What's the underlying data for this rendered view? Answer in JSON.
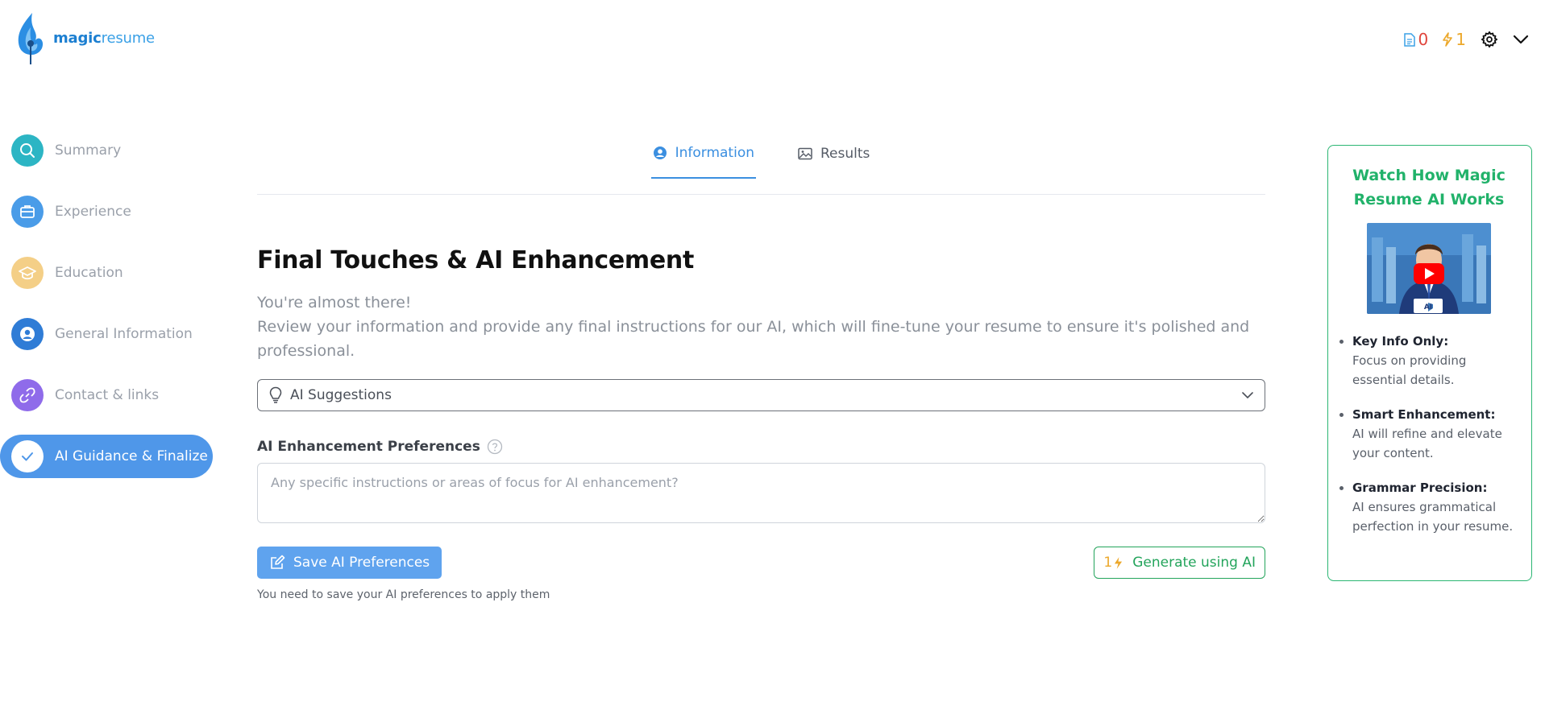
{
  "brand": {
    "part1": "magic",
    "part2": "resume"
  },
  "header": {
    "documents_count": "0",
    "credits_count": "1"
  },
  "sidebar": {
    "items": [
      {
        "label": "Summary",
        "icon": "search-icon",
        "color": "#2cb5c4"
      },
      {
        "label": "Experience",
        "icon": "briefcase-icon",
        "color": "#4a9ce8"
      },
      {
        "label": "Education",
        "icon": "graduation-cap-icon",
        "color": "#f4cf87"
      },
      {
        "label": "General Information",
        "icon": "user-circle-icon",
        "color": "#2f7cd6"
      },
      {
        "label": "Contact & links",
        "icon": "link-icon",
        "color": "#8f6bea"
      },
      {
        "label": "AI Guidance & Finalize",
        "icon": "check-icon",
        "color": "#4f97e9",
        "active": true
      }
    ]
  },
  "tabs": [
    {
      "label": "Information",
      "icon": "user-circle-icon",
      "active": true
    },
    {
      "label": "Results",
      "icon": "image-icon",
      "active": false
    }
  ],
  "main": {
    "title": "Final Touches & AI Enhancement",
    "intro_line1": "You're almost there!",
    "intro_line2": "Review your information and provide any final instructions for our AI, which will fine-tune your resume to ensure it's polished and professional.",
    "suggestions_label": "AI Suggestions",
    "preferences_label": "AI Enhancement Preferences",
    "preferences_placeholder": "Any specific instructions or areas of focus for AI enhancement?",
    "preferences_value": "",
    "save_label": "Save AI Preferences",
    "generate_cost": "1",
    "generate_label": "Generate using AI",
    "save_hint": "You need to save your AI preferences to apply them"
  },
  "panel": {
    "title": "Watch How Magic Resume AI Works",
    "tips": [
      {
        "title": "Key Info Only:",
        "text": "Focus on providing essential details."
      },
      {
        "title": "Smart Enhancement:",
        "text": "AI will refine and elevate your content."
      },
      {
        "title": "Grammar Precision:",
        "text": "AI ensures grammatical perfection in your resume."
      }
    ],
    "video_badge": "AI"
  },
  "colors": {
    "accent": "#4f97e9",
    "green": "#23a45b",
    "amber": "#eca82b",
    "red": "#e0443b"
  }
}
